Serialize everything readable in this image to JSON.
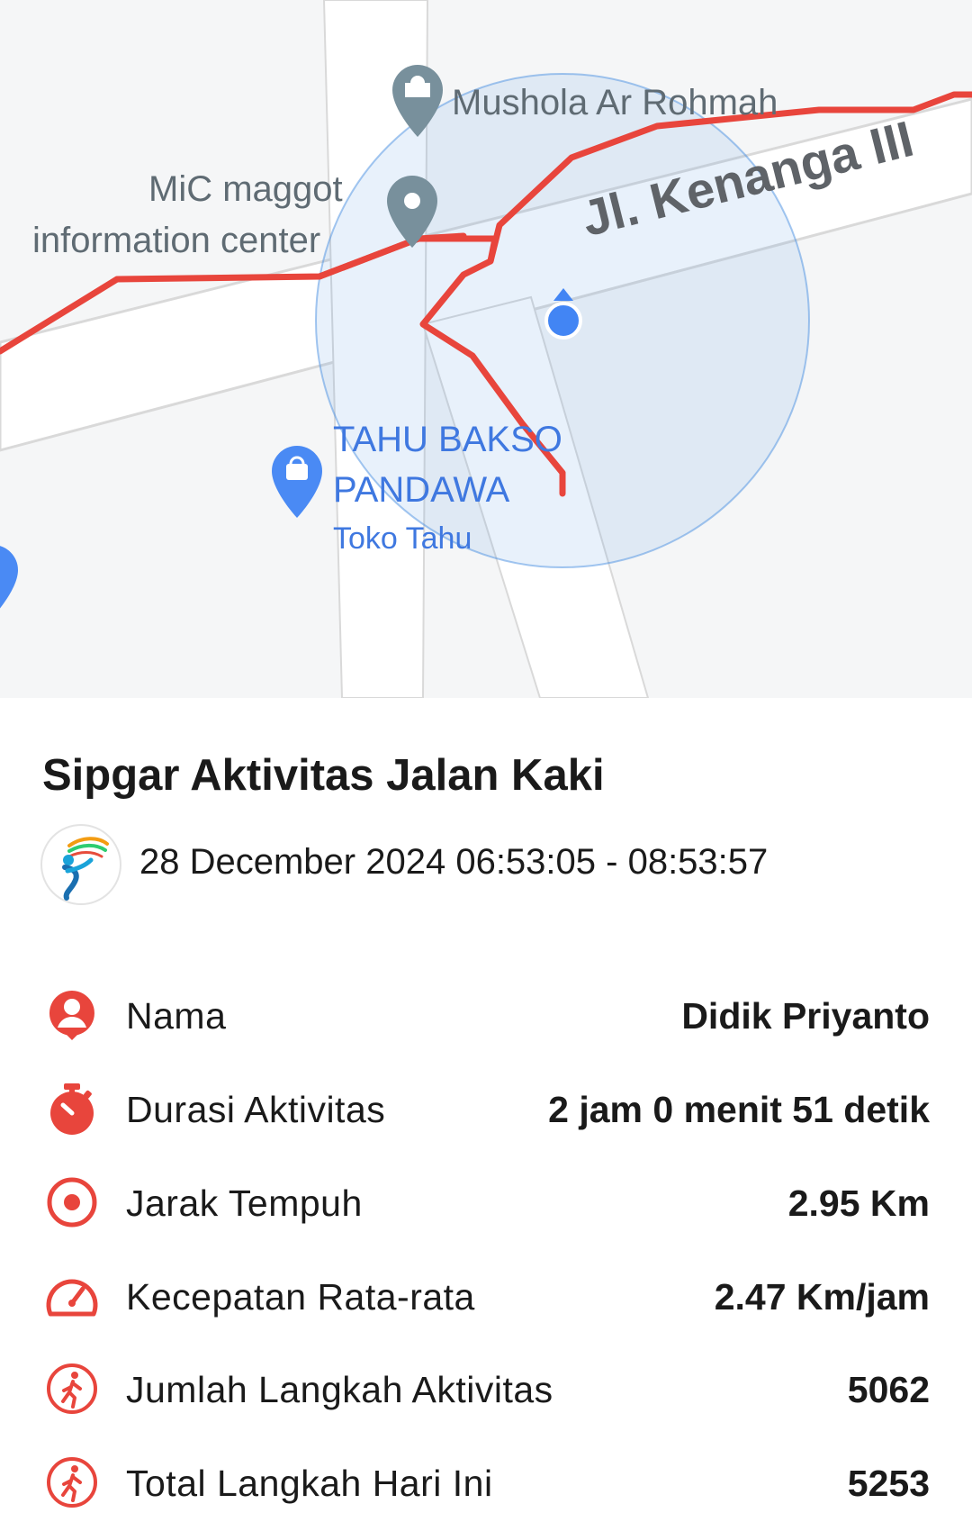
{
  "map": {
    "poi_mushola": "Mushola Ar Rohmah",
    "poi_mic_line1": "MiC maggot",
    "poi_mic_line2": "information center",
    "road_label": "Jl. Kenanga III",
    "poi_tahu_line1": "TAHU BAKSO",
    "poi_tahu_line2": "PANDAWA",
    "poi_tahu_sub": "Toko Tahu",
    "route_color": "#e8453c",
    "accuracy_circle_color": "#4a90e2",
    "location_dot_color": "#4285f4"
  },
  "activity": {
    "title": "Sipgar Aktivitas Jalan Kaki",
    "datetime": "28 December 2024 06:53:05 - 08:53:57",
    "logo_icon": "runner-logo-icon"
  },
  "stats": [
    {
      "icon": "person-icon",
      "label": "Nama",
      "value": "Didik Priyanto"
    },
    {
      "icon": "stopwatch-icon",
      "label": "Durasi Aktivitas",
      "value": "2 jam 0 menit 51 detik"
    },
    {
      "icon": "target-icon",
      "label": "Jarak Tempuh",
      "value": "2.95 Km"
    },
    {
      "icon": "speedometer-icon",
      "label": "Kecepatan Rata-rata",
      "value": "2.47 Km/jam"
    },
    {
      "icon": "walking-icon",
      "label": "Jumlah Langkah Aktivitas",
      "value": "5062"
    },
    {
      "icon": "walking-icon",
      "label": "Total Langkah Hari Ini",
      "value": "5253"
    }
  ],
  "accent_color": "#e8453c"
}
